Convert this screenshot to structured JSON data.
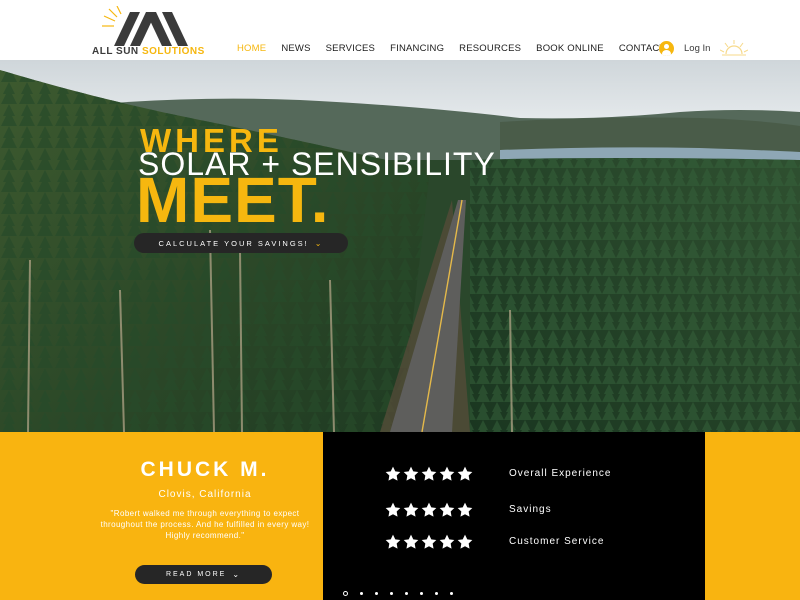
{
  "brand": {
    "name_part1": "ALL SUN ",
    "name_part2": "SOLUTIONS",
    "accent": "#f6b70f"
  },
  "nav": {
    "items": [
      {
        "label": "HOME",
        "active": true
      },
      {
        "label": "NEWS"
      },
      {
        "label": "SERVICES"
      },
      {
        "label": "FINANCING"
      },
      {
        "label": "RESOURCES"
      },
      {
        "label": "BOOK ONLINE"
      },
      {
        "label": "CONTACT"
      }
    ],
    "login_label": "Log In"
  },
  "hero": {
    "line1": "WHERE",
    "line2": "SOLAR + SENSIBILITY",
    "line3": "MEET.",
    "cta_label": "CALCULATE YOUR SAVINGS!"
  },
  "testimonial": {
    "name": "CHUCK M.",
    "location": "Clovis, California",
    "quote": "\"Robert walked me through everything to expect throughout the process. And he fulfilled in every way! Highly recommend.\"",
    "read_more_label": "READ MORE",
    "ratings": [
      {
        "label": "Overall Experience",
        "stars": 5
      },
      {
        "label": "Savings",
        "stars": 5
      },
      {
        "label": "Customer Service",
        "stars": 5
      }
    ],
    "slides": 8,
    "active_slide": 0
  }
}
